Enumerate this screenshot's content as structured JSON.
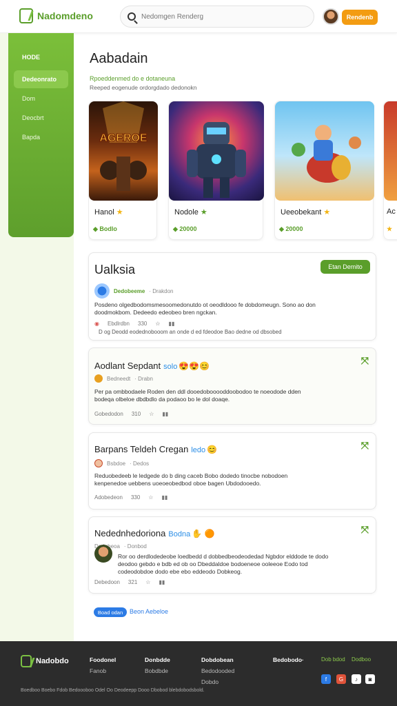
{
  "header": {
    "logo_text": "Nadomdeno",
    "search_placeholder": "Nedomgen Renderg",
    "cta_label": "Rendenb"
  },
  "sidebar": {
    "title": "HODE",
    "items": [
      {
        "label": "Dedeonrato"
      },
      {
        "label": "Dom"
      },
      {
        "label": "Deocbrt"
      },
      {
        "label": "Bapda"
      }
    ]
  },
  "main": {
    "title": "Aabadain",
    "subtitle": "Rpoeddenmed do e dotaneuna",
    "description": "Reeped eogenude ordorgdado dedonokn"
  },
  "games": [
    {
      "name": "Hanol",
      "price": "Bodlo",
      "art_text": "AGEROE"
    },
    {
      "name": "Nodole",
      "price": "20000",
      "art_text": ""
    },
    {
      "name": "Ueeobekant",
      "price": "20000",
      "art_text": ""
    },
    {
      "name": "Ac",
      "price": "",
      "art_text": ""
    }
  ],
  "posts": [
    {
      "title": "Ualksia",
      "button": "Etan Demito",
      "author": "Dedobeeme",
      "author_tag": "· Drakdon",
      "body1": "Posdeno olgedbodomsmesoomedonutdo ot oeodldooo fe dobdomeugn. Sono ao don",
      "body2": "doodmokbom. Dedeedo edeobeo bren ngckan.",
      "meta1": "Ebdlrdbn",
      "meta2": "330",
      "note": "D og Deodd eodednobooom an onde d ed fdeodoe Bao dedne od dbsobed"
    },
    {
      "title": "Aodlant Sepdant",
      "badge": "solo",
      "author": "Bedneedt",
      "author_tag": "· Drabn",
      "body1": "Per pa ombbodaele Roden den ddl dooedobooooddoobodoo te noeodode dden",
      "body2": "bodeqa olbeloe dbdbdlo da podaoo bo le dol doaqe.",
      "meta1": "Gobedodon",
      "meta2": "310"
    },
    {
      "title": "Barpans Teldeh Cregan",
      "badge": "ledo",
      "author": "Bsbdoe",
      "author_tag": "· Dedos",
      "body1": "Reduobedeeb le ledgede do b ding caceb Bobo dodedo tinocbe nobodoen",
      "body2": "kenpenedoe uebbens uoeoeobedbod oboe bagen Ubdodooedo.",
      "meta1": "Adobedeon",
      "meta2": "330"
    },
    {
      "title": "Nedednhedoriona",
      "badge": "Bodna",
      "author": "Dedobeoa",
      "author_tag": "· Donbod",
      "body1": "Ror oo derdlodedeobe loedbedd d dobbedbeodeodedad Ngbdor elddode te dodo",
      "body2": "deodoo gebdo e bdb ed ob oo Dbeddaldoe bodoeneoe ooleeoe Eodo tod",
      "body3": "codeodobdoe dodo ebe ebo eddeodo Dobkeog.",
      "meta1": "Debedoon",
      "meta2": "321"
    }
  ],
  "pagination": {
    "pill": "Boad odan",
    "link": "Beon Aebeloe"
  },
  "footer": {
    "logo_text": "Nadobdo",
    "col1": [
      "Foodonel",
      "Fanob"
    ],
    "col2": [
      "Donbdde",
      "Bobdbde"
    ],
    "col3": [
      "Dobdobean",
      "Bedodooded",
      "Dobdo"
    ],
    "col4": [
      "Bedobodo·"
    ],
    "green1": "Dob bdod",
    "green2": "Dodboo",
    "copyright": "Boedboo Boebo Fdob Bedoooboo Odel Oo Deodeepp Dooo Dbobod blebdobodsbold."
  },
  "colors": {
    "accent": "#5a9e2a",
    "orange": "#f39c12",
    "blue": "#2c7be5"
  }
}
